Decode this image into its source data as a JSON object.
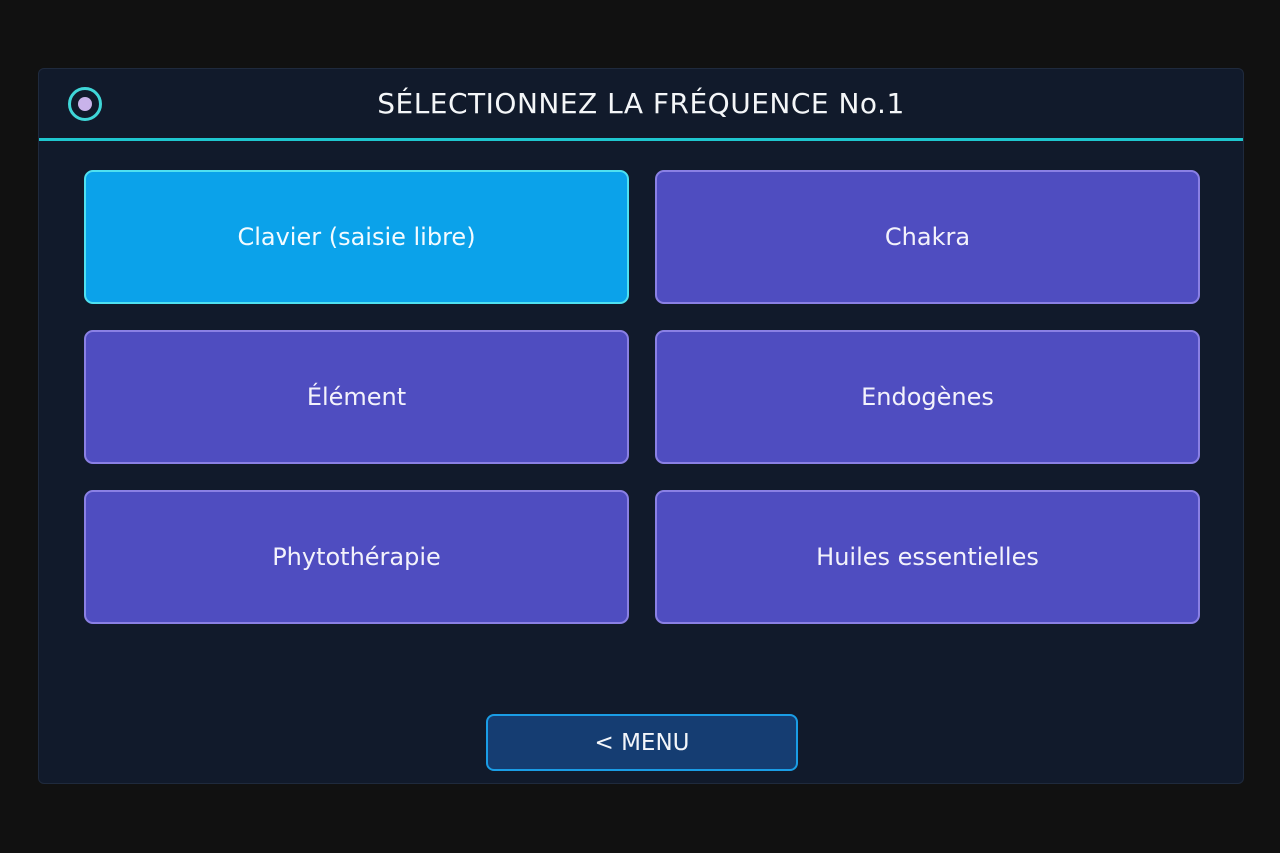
{
  "header": {
    "title": "SÉLECTIONNEZ LA FRÉQUENCE No.1",
    "icon": "radio-indicator-icon"
  },
  "options": [
    {
      "label": "Clavier (saisie libre)",
      "selected": true
    },
    {
      "label": "Chakra",
      "selected": false
    },
    {
      "label": "Élément",
      "selected": false
    },
    {
      "label": "Endogènes",
      "selected": false
    },
    {
      "label": "Phytothérapie",
      "selected": false
    },
    {
      "label": "Huiles essentielles",
      "selected": false
    }
  ],
  "footer": {
    "menu_label": "< MENU"
  },
  "colors": {
    "accent": "#1fc7cf",
    "selected_tile": "#0ba2ea",
    "tile": "#4f4dc0",
    "menu_button": "#153d72"
  }
}
